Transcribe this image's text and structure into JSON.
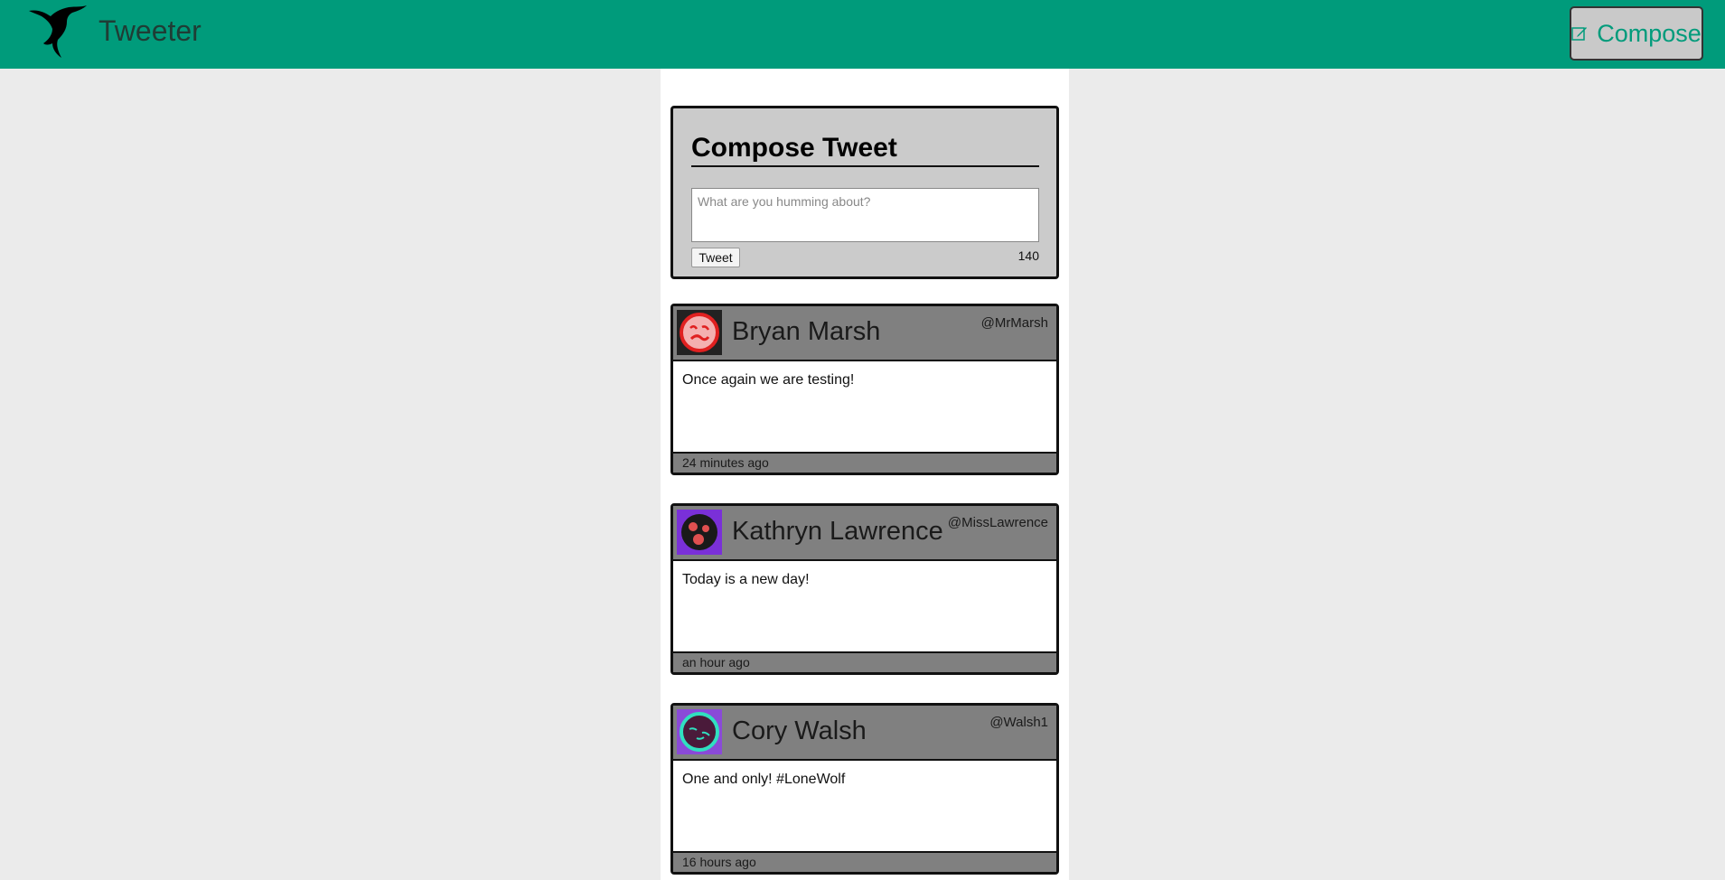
{
  "navbar": {
    "brand": "Tweeter",
    "compose_label": "Compose",
    "colors": {
      "background": "#009b7b",
      "brand_text": "#1f3d35",
      "compose_text": "#009b7b"
    }
  },
  "compose": {
    "title": "Compose Tweet",
    "placeholder": "What are you humming about?",
    "tweet_button": "Tweet",
    "counter": "140"
  },
  "tweets": [
    {
      "name": "Bryan Marsh",
      "handle": "@MrMarsh",
      "text": "Once again we are testing!",
      "time": "24 minutes ago",
      "avatar": {
        "icon": "red-face-avatar-icon",
        "bg": "#222222",
        "ring": "#e02020",
        "face": "#f4b0b0"
      }
    },
    {
      "name": "Kathryn Lawrence",
      "handle": "@MissLawrence",
      "text": "Today is a new day!",
      "time": "an hour ago",
      "avatar": {
        "icon": "purple-face-avatar-icon",
        "bg": "#7a30d8",
        "ring": "#1a1a1a",
        "face": "#e05050"
      }
    },
    {
      "name": "Cory Walsh",
      "handle": "@Walsh1",
      "text": "One and only! #LoneWolf",
      "time": "16 hours ago",
      "avatar": {
        "icon": "teal-face-avatar-icon",
        "bg": "#8a4ad8",
        "ring": "#30e0c0",
        "face": "#4a1a3a"
      }
    }
  ]
}
